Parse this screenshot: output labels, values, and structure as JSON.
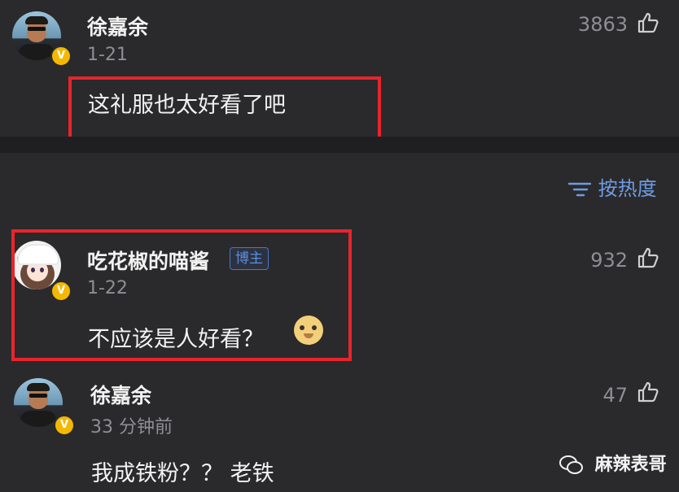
{
  "comments": [
    {
      "user": "徐嘉余",
      "date": "1-21",
      "text": "这礼服也太好看了吧",
      "likes": "3863",
      "verified": "V"
    },
    {
      "user": "吃花椒的喵酱",
      "tag": "博主",
      "date": "1-22",
      "text": "不应该是人好看？",
      "likes": "932",
      "verified": "V"
    },
    {
      "user": "徐嘉余",
      "date": "33 分钟前",
      "text": "我成铁粉？？ 老铁",
      "likes": "47",
      "verified": "V"
    }
  ],
  "sort": {
    "label": "按热度"
  },
  "watermark": {
    "label": "麻辣表哥"
  },
  "colors": {
    "highlight": "#e8242c",
    "accent": "#6e9be3",
    "badge": "#f5b800",
    "background": "#2a2a2c"
  },
  "icons": {
    "like": "thumbs-up-icon",
    "sort": "sort-icon",
    "wechat": "wechat-icon",
    "verified": "verified-badge-icon"
  }
}
